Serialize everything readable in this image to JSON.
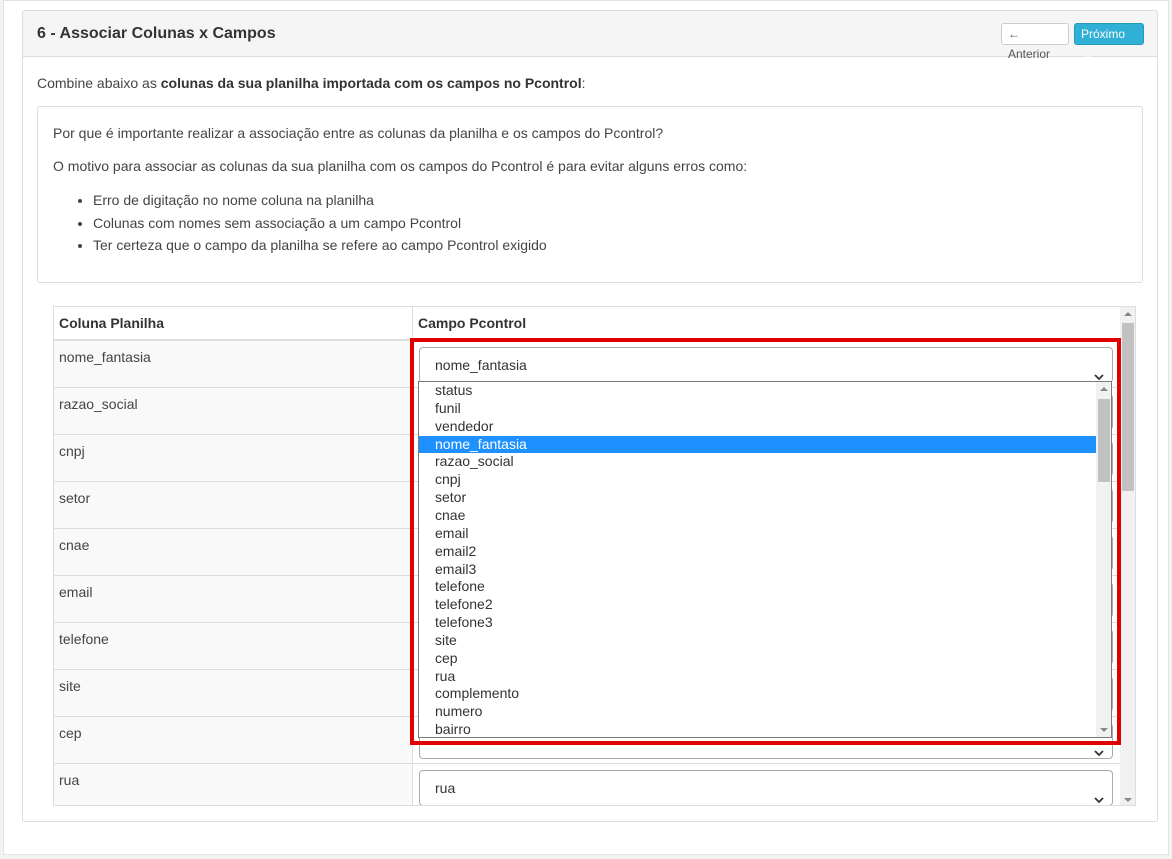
{
  "header": {
    "title": "6 - Associar Colunas x Campos",
    "prev_label": "← Anterior",
    "next_label": "Próximo →"
  },
  "intro": {
    "prefix": "Combine abaixo as ",
    "bold": "colunas da sua planilha importada com os campos no Pcontrol",
    "suffix": ":"
  },
  "info": {
    "question": "Por que é importante realizar a associação entre as colunas da planilha e os campos do Pcontrol?",
    "reason": "O motivo para associar as colunas da sua planilha com os campos do Pcontrol é para evitar alguns erros como:",
    "items": [
      "Erro de digitação no nome coluna na planilha",
      "Colunas com nomes sem associação a um campo Pcontrol",
      "Ter certeza que o campo da planilha se refere ao campo Pcontrol exigido"
    ]
  },
  "table": {
    "col1": "Coluna Planilha",
    "col2": "Campo Pcontrol",
    "rows": [
      {
        "col": "nome_fantasia",
        "field": "nome_fantasia"
      },
      {
        "col": "razao_social",
        "field": ""
      },
      {
        "col": "cnpj",
        "field": ""
      },
      {
        "col": "setor",
        "field": ""
      },
      {
        "col": "cnae",
        "field": ""
      },
      {
        "col": "email",
        "field": ""
      },
      {
        "col": "telefone",
        "field": ""
      },
      {
        "col": "site",
        "field": ""
      },
      {
        "col": "cep",
        "field": ""
      },
      {
        "col": "rua",
        "field": "rua"
      }
    ]
  },
  "dropdown": {
    "selected": "nome_fantasia",
    "options": [
      "status",
      "funil",
      "vendedor",
      "nome_fantasia",
      "razao_social",
      "cnpj",
      "setor",
      "cnae",
      "email",
      "email2",
      "email3",
      "telefone",
      "telefone2",
      "telefone3",
      "site",
      "cep",
      "rua",
      "complemento",
      "numero",
      "bairro"
    ]
  },
  "colors": {
    "highlight": "#e00000",
    "selected_option": "#1e90ff",
    "next_button": "#31b0d5"
  }
}
